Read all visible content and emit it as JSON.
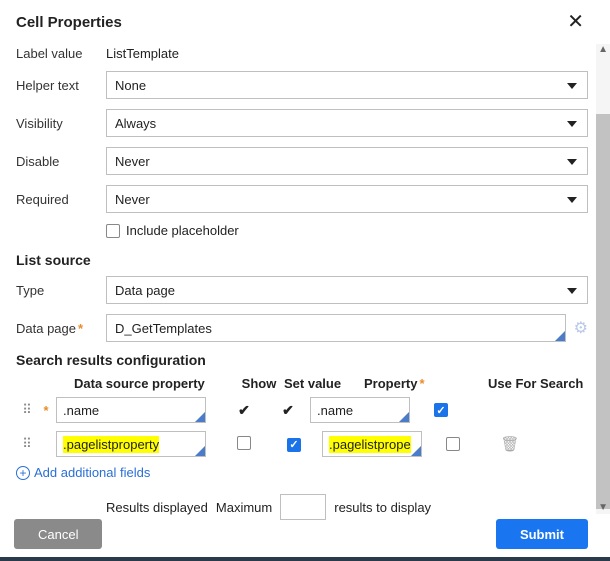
{
  "header": {
    "title": "Cell Properties"
  },
  "fields": {
    "labelValue": {
      "label": "Label value",
      "value": "ListTemplate"
    },
    "helperText": {
      "label": "Helper text",
      "value": "None"
    },
    "visibility": {
      "label": "Visibility",
      "value": "Always"
    },
    "disable": {
      "label": "Disable",
      "value": "Never"
    },
    "required": {
      "label": "Required",
      "value": "Never"
    },
    "includePlaceholder": {
      "label": "Include placeholder",
      "checked": false
    }
  },
  "listSource": {
    "title": "List source",
    "type": {
      "label": "Type",
      "value": "Data page"
    },
    "dataPage": {
      "label": "Data page",
      "value": "D_GetTemplates"
    }
  },
  "searchConfig": {
    "title": "Search results configuration",
    "columns": {
      "dsp": "Data source property",
      "show": "Show",
      "set": "Set value",
      "prop": "Property",
      "ufs": "Use For Search"
    },
    "rows": [
      {
        "required": true,
        "dsp": ".name",
        "show": true,
        "set": true,
        "prop": ".name",
        "ufs": true,
        "highlight": false,
        "deletable": false
      },
      {
        "required": false,
        "dsp": ".pagelistproperty",
        "show": false,
        "set": true,
        "prop": ".pagelistprope",
        "ufs": false,
        "highlight": true,
        "deletable": true
      }
    ],
    "addLink": "Add additional fields"
  },
  "resultsLine": {
    "left": "Results displayed",
    "mid": "Maximum",
    "right": "results to display",
    "value": ""
  },
  "footer": {
    "cancel": "Cancel",
    "submit": "Submit"
  }
}
